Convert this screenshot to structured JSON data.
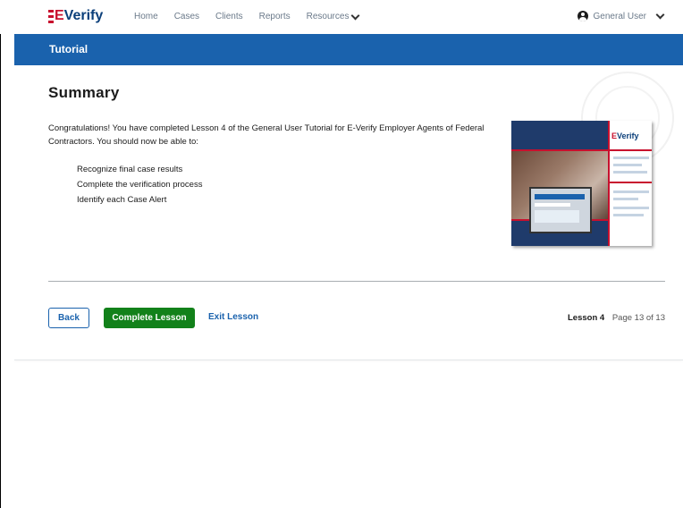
{
  "brand": {
    "logo_e": "E",
    "logo_text": "Verify"
  },
  "nav": {
    "items": [
      "Home",
      "Cases",
      "Clients",
      "Reports",
      "Resources"
    ]
  },
  "user": {
    "name": "General User"
  },
  "banner": {
    "title": "Tutorial"
  },
  "page": {
    "title": "Summary",
    "intro": "Congratulations! You have completed Lesson 4 of the General User Tutorial for E-Verify Employer Agents of Federal Contractors. You should now be able to:",
    "objectives": [
      "Recognize final case results",
      "Complete the verification process",
      "Identify each Case Alert"
    ]
  },
  "thumbnail": {
    "logo_e": "E",
    "logo_text": "Verify"
  },
  "footer": {
    "back_label": "Back",
    "complete_label": "Complete Lesson",
    "exit_label": "Exit Lesson",
    "lesson_label": "Lesson 4",
    "page_label": "Page 13 of 13"
  },
  "colors": {
    "banner": "#1a62ad",
    "primary_button": "#12811a",
    "link": "#1a62ad",
    "brand_red": "#c8102e",
    "brand_navy": "#0b3f7a"
  }
}
